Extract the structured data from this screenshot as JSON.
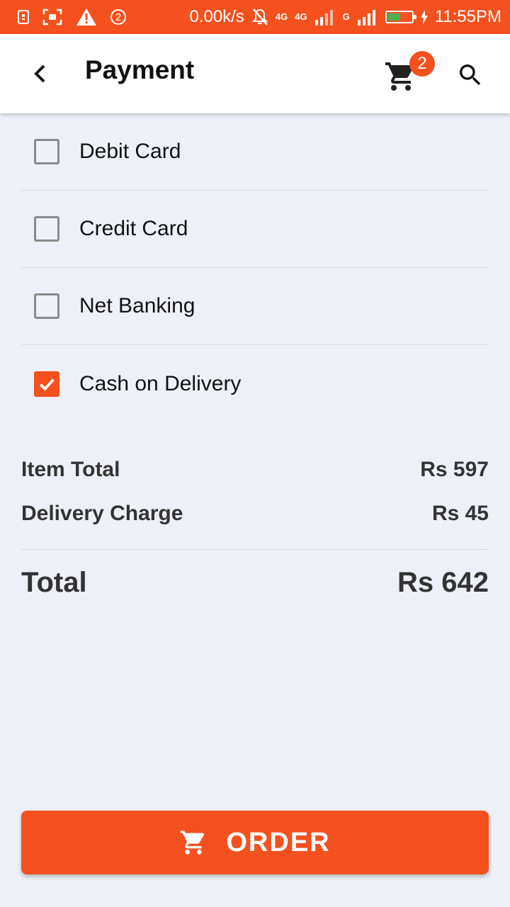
{
  "status_bar": {
    "network_speed": "0.00k/s",
    "notification_count": "2",
    "network_4g_a": "4G",
    "network_4g_b": "4G",
    "network_g": "G",
    "time": "11:55PM",
    "battery_level_percent": 60,
    "background_color": "#f4511e"
  },
  "app_bar": {
    "title": "Payment",
    "cart_badge_count": "2",
    "icons": [
      "back-arrow",
      "cart",
      "search"
    ]
  },
  "payment_options": [
    {
      "label": "Debit Card",
      "checked": false
    },
    {
      "label": "Credit Card",
      "checked": false
    },
    {
      "label": "Net Banking",
      "checked": false
    },
    {
      "label": "Cash on Delivery",
      "checked": true
    }
  ],
  "summary": {
    "item_total_label": "Item Total",
    "item_total_value": "Rs 597",
    "delivery_label": "Delivery Charge",
    "delivery_value": "Rs 45",
    "total_label": "Total",
    "total_value": "Rs 642"
  },
  "order_button": {
    "label": "ORDER",
    "icon": "cart"
  },
  "colors": {
    "accent": "#f4511e",
    "background": "#eef0f8",
    "text": "#111111"
  }
}
